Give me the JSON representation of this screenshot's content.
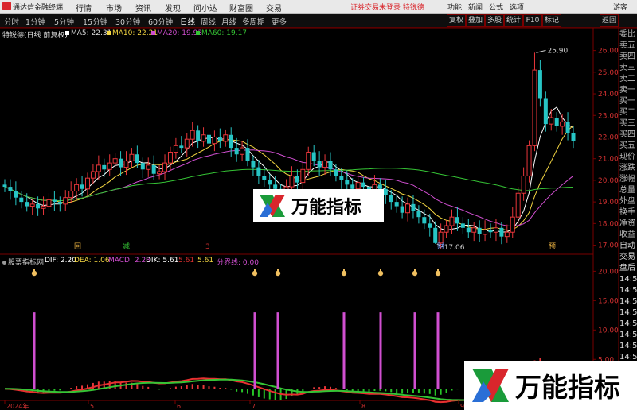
{
  "app": {
    "title": "通达信金融终端"
  },
  "menu": {
    "items": [
      "行情",
      "市场",
      "资讯",
      "发现",
      "问小达",
      "财富圈",
      "交易"
    ],
    "warning": "证券交易未登录",
    "warning_tag": "特锐德",
    "right_items": [
      "功能",
      "新闻",
      "公式",
      "选项",
      "游客"
    ]
  },
  "toolbar": {
    "periods": [
      "分时",
      "1分钟",
      "5分钟",
      "15分钟",
      "30分钟",
      "60分钟",
      "日线",
      "周线",
      "月线",
      "多周期",
      "更多"
    ],
    "active": "日线",
    "right_buttons": [
      "复权",
      "叠加",
      "多股",
      "统计",
      "F10",
      "标记",
      "返回"
    ]
  },
  "kline": {
    "stock_label": "特锐德(日线 前复权)",
    "ma": [
      {
        "label": "MA5: 22.31",
        "color": "#ffffff"
      },
      {
        "label": "MA10: 22.21",
        "color": "#f5d742"
      },
      {
        "label": "MA20: 19.93",
        "color": "#d14fd1"
      },
      {
        "label": "MA60: 19.17",
        "color": "#35c435"
      }
    ],
    "y_ticks": [
      "26.00",
      "25.00",
      "24.00",
      "23.00",
      "22.00",
      "21.00",
      "20.00",
      "19.00",
      "18.00",
      "17.00"
    ],
    "high_label": "25.90",
    "low_label": "17.06",
    "bottom_markers": [
      "回",
      "减",
      "3",
      "财",
      "预"
    ]
  },
  "macd": {
    "indicator": "股票指标网",
    "values": [
      {
        "label": "DIF: 2.20",
        "color": "#ffffff"
      },
      {
        "label": "DEA: 1.06",
        "color": "#f5d742"
      },
      {
        "label": "MACD: 2.28",
        "color": "#d14fd1"
      },
      {
        "label": "DIK: 5.61",
        "color": "#ffffff"
      },
      {
        "label": "5.61",
        "color": "#e03030"
      },
      {
        "label": "5.61",
        "color": "#f5d742"
      },
      {
        "label": "分界线: 0.00",
        "color": "#d14fd1"
      }
    ],
    "y_ticks": [
      "20.00",
      "15.00",
      "10.00",
      "5.00"
    ]
  },
  "xaxis": {
    "labels": [
      "2024年",
      "5",
      "6",
      "7",
      "8",
      "9"
    ]
  },
  "rightpanel": {
    "items": [
      "委比",
      "卖五",
      "卖四",
      "卖三",
      "卖二",
      "卖一",
      "买一",
      "买二",
      "买三",
      "买四",
      "买五",
      "现价",
      "涨跌",
      "涨幅",
      "总量",
      "外盘",
      "换手",
      "净资",
      "收益",
      "自动",
      "交易",
      "盘后",
      "14:5",
      "14:5",
      "14:5",
      "14:5",
      "14:5",
      "14:5",
      "14:5",
      "14:5",
      "14:5",
      "14:5",
      "14:5"
    ]
  },
  "watermark": {
    "text": "万能指标"
  },
  "chart_data": {
    "type": "candlestick",
    "title": "特锐德(日线 前复权)",
    "ylim": [
      16.8,
      26.5
    ],
    "y_ticks": [
      26,
      25,
      24,
      23,
      22,
      21,
      20,
      19,
      18,
      17
    ],
    "high": 25.9,
    "low": 17.06,
    "ma_last": {
      "MA5": 22.31,
      "MA10": 22.21,
      "MA20": 19.93,
      "MA60": 19.17
    },
    "close": [
      19.7,
      19.5,
      19.2,
      19.0,
      18.8,
      18.9,
      18.7,
      18.8,
      19.1,
      19.0,
      18.9,
      19.2,
      19.5,
      19.8,
      19.6,
      20.1,
      20.4,
      20.7,
      20.5,
      20.8,
      21.0,
      20.6,
      20.9,
      21.2,
      20.8,
      20.5,
      20.7,
      20.3,
      20.4,
      20.8,
      21.3,
      21.6,
      21.5,
      21.9,
      22.3,
      21.8,
      22.1,
      21.7,
      22.0,
      21.8,
      22.1,
      21.5,
      21.2,
      21.5,
      20.9,
      20.6,
      20.2,
      20.0,
      19.8,
      19.6,
      19.4,
      19.7,
      20.2,
      19.9,
      20.5,
      21.3,
      20.9,
      20.6,
      20.9,
      20.5,
      20.2,
      20.0,
      19.8,
      19.6,
      19.9,
      19.7,
      19.5,
      19.8,
      19.6,
      19.3,
      19.0,
      18.8,
      18.5,
      18.9,
      18.6,
      18.3,
      18.0,
      17.8,
      17.1,
      17.6,
      17.9,
      18.3,
      18.0,
      17.8,
      17.6,
      17.8,
      17.5,
      17.7,
      17.6,
      17.8,
      17.4,
      17.6,
      18.3,
      19.4,
      20.2,
      21.6,
      25.1,
      23.8,
      22.6,
      22.9,
      22.5,
      22.7,
      22.2,
      21.8
    ],
    "open": [
      19.8,
      19.7,
      19.5,
      19.2,
      19.0,
      18.8,
      18.9,
      18.7,
      18.8,
      19.1,
      19.0,
      18.9,
      19.2,
      19.5,
      19.8,
      19.6,
      20.1,
      20.4,
      20.7,
      20.5,
      20.8,
      21.0,
      20.6,
      20.9,
      21.2,
      20.8,
      20.5,
      20.7,
      20.3,
      20.4,
      20.8,
      21.3,
      21.6,
      21.5,
      21.9,
      22.3,
      21.8,
      22.1,
      21.7,
      22.0,
      21.8,
      22.1,
      21.5,
      21.2,
      21.5,
      20.9,
      20.6,
      20.2,
      20.0,
      19.8,
      19.6,
      19.4,
      19.7,
      20.2,
      19.9,
      20.5,
      21.3,
      20.9,
      20.6,
      20.9,
      20.5,
      20.2,
      20.0,
      19.8,
      19.6,
      19.9,
      19.7,
      19.5,
      19.8,
      19.6,
      19.3,
      19.0,
      18.8,
      18.5,
      18.9,
      18.6,
      18.3,
      18.0,
      17.8,
      17.1,
      17.6,
      17.9,
      18.3,
      18.0,
      17.8,
      17.6,
      17.8,
      17.5,
      17.7,
      17.6,
      17.8,
      17.4,
      17.6,
      18.3,
      19.4,
      20.2,
      21.6,
      25.1,
      23.8,
      22.6,
      22.9,
      22.5,
      22.7,
      22.2
    ]
  }
}
